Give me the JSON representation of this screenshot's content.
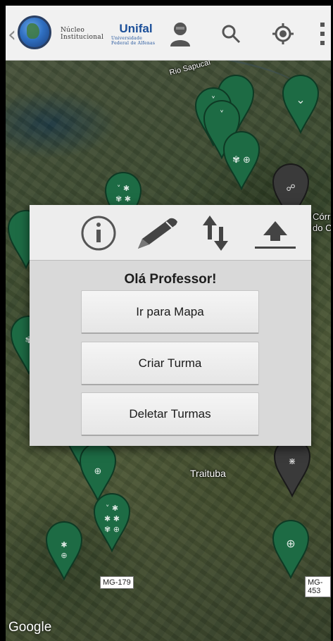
{
  "toolbar": {
    "logo1_text": "Núcleo Institucional",
    "logo2_text": "Unifal",
    "logo2_sub": "Universidade Federal de Alfenas",
    "icons": [
      "back-chevron",
      "globe-logo",
      "institution-logo",
      "unifal-logo",
      "profile-icon",
      "search-icon",
      "locate-icon",
      "overflow-menu-icon"
    ]
  },
  "map": {
    "labels": {
      "river": "Rio Sapucaí",
      "corrego": "Córr do C",
      "town": "Traituba"
    },
    "roads": [
      "MG-179",
      "MG-453"
    ],
    "attribution": "Google",
    "marker_colors": {
      "green": "#1d6b44",
      "dark": "#3a3a3a"
    }
  },
  "dialog": {
    "icons": [
      "info-icon",
      "edit-pencil-icon",
      "sort-arrows-icon",
      "upload-icon"
    ],
    "title": "Olá Professor!",
    "buttons": {
      "map": "Ir para Mapa",
      "create": "Criar Turma",
      "delete": "Deletar Turmas"
    }
  }
}
